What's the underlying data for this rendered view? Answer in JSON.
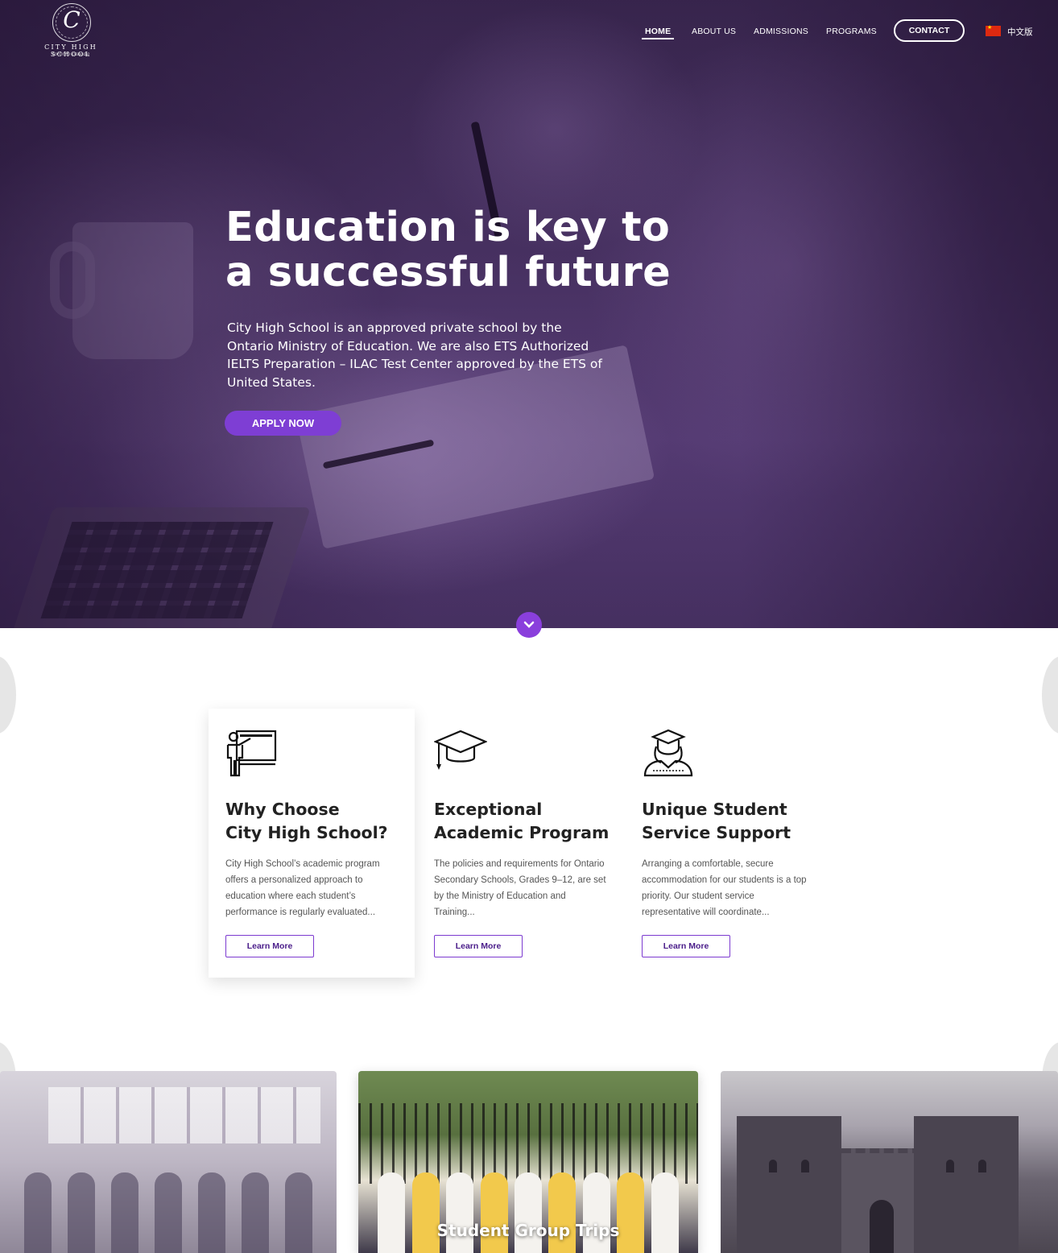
{
  "logo": {
    "letter": "C",
    "name": "CITY HIGH SCHOOL",
    "sub": "toronto canada"
  },
  "nav": {
    "items": [
      {
        "label": "HOME",
        "active": true
      },
      {
        "label": "ABOUT US"
      },
      {
        "label": "ADMISSIONS"
      },
      {
        "label": "PROGRAMS"
      }
    ],
    "contact": "CONTACT",
    "language": "中文版"
  },
  "hero": {
    "title_line1": "Education is key to",
    "title_line2": "a successful future",
    "text": "City High School is an approved private school by the Ontario Ministry of Education. We are also ETS Authorized IELTS Preparation  – ILAC Test Center approved by the ETS of United States.",
    "cta": "APPLY NOW"
  },
  "features": [
    {
      "icon": "teacher-board-icon",
      "title_line1": "Why Choose",
      "title_line2": "City High School?",
      "text": "City High School’s academic program offers a personalized approach to education where each student’s performance is regularly evaluated...",
      "button": "Learn More"
    },
    {
      "icon": "graduation-cap-icon",
      "title_line1": "Exceptional",
      "title_line2": "Academic Program",
      "text": "The policies and requirements for Ontario Secondary Schools, Grades 9–12, are set by the Ministry of Education and Training...",
      "button": "Learn More"
    },
    {
      "icon": "student-graduate-icon",
      "title_line1": "Unique Student",
      "title_line2": "Service Support",
      "text": "Arranging a comfortable, secure accommodation for our students is a top priority. Our student service representative will coordinate...",
      "button": "Learn More"
    }
  ],
  "photos": {
    "trip_title": "Student Group Trips"
  },
  "colors": {
    "accent": "#7e3ed4",
    "hero_overlay": "#4b3466"
  }
}
